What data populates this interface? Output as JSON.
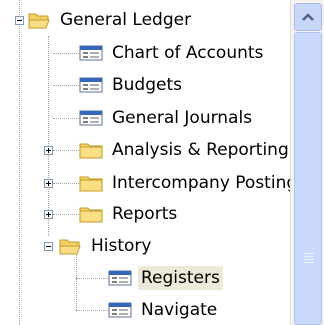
{
  "tree": {
    "general_ledger": "General Ledger",
    "items": [
      {
        "label": "Chart of Accounts"
      },
      {
        "label": "Budgets"
      },
      {
        "label": "General Journals"
      },
      {
        "label": "Analysis & Reporting"
      },
      {
        "label": "Intercompany Posting"
      },
      {
        "label": "Reports"
      },
      {
        "label": "History"
      }
    ],
    "history_children": [
      {
        "label": "Registers"
      },
      {
        "label": "Navigate"
      }
    ]
  }
}
